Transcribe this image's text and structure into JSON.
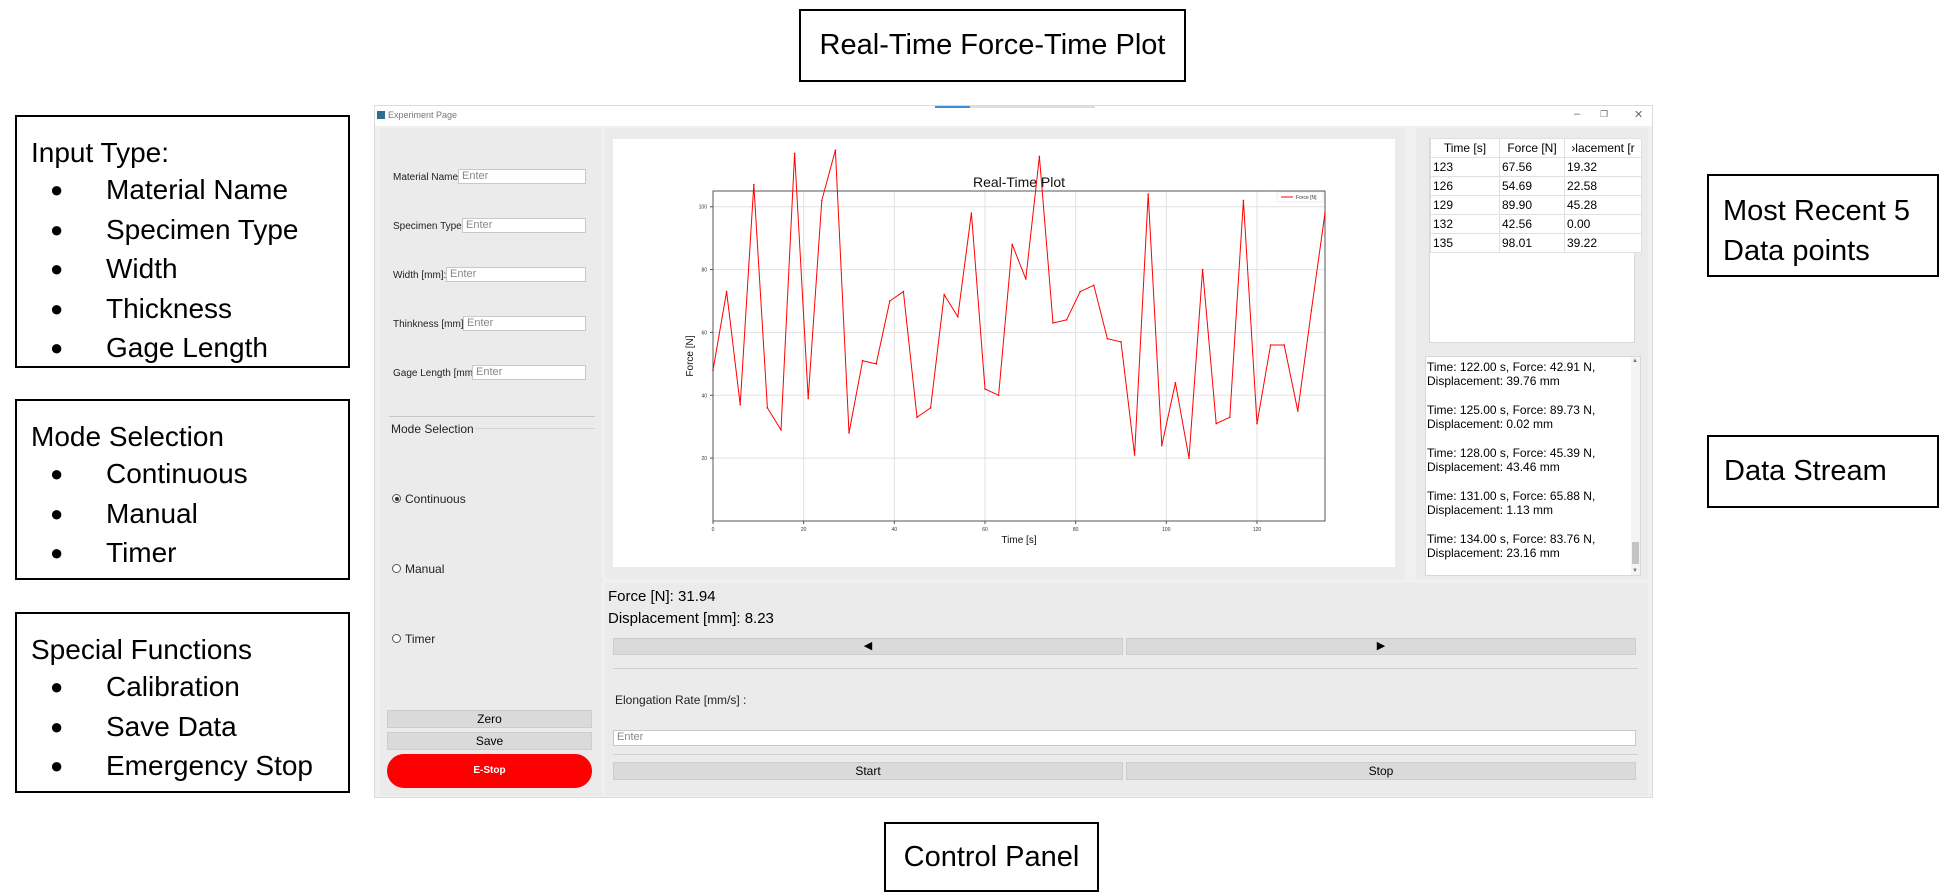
{
  "annotations": {
    "top": "Real-Time Force-Time Plot",
    "bottom": "Control Panel",
    "right_recent": [
      "Most Recent 5",
      "Data points"
    ],
    "right_stream": "Data Stream",
    "input_type": {
      "title": "Input Type:",
      "items": [
        "Material Name",
        "Specimen Type",
        "Width",
        "Thickness",
        "Gage Length"
      ]
    },
    "mode_selection": {
      "title": "Mode Selection",
      "items": [
        "Continuous",
        "Manual",
        "Timer"
      ]
    },
    "special_functions": {
      "title": "Special Functions",
      "items": [
        "Calibration",
        "Save Data",
        "Emergency Stop"
      ]
    }
  },
  "window": {
    "title": "Experiment Page",
    "controls": [
      "–",
      "❐",
      "✕"
    ]
  },
  "inputs": [
    {
      "label": "Material Name:",
      "placeholder": "Enter"
    },
    {
      "label": "Specimen Type:",
      "placeholder": "Enter"
    },
    {
      "label": "Width [mm]:",
      "placeholder": "Enter"
    },
    {
      "label": "Thinkness [mm]:",
      "placeholder": "Enter"
    },
    {
      "label": "Gage Length [mm]:",
      "placeholder": "Enter"
    }
  ],
  "mode": {
    "title": "Mode Selection",
    "options": [
      "Continuous",
      "Manual",
      "Timer"
    ],
    "selected": "Continuous"
  },
  "buttons": {
    "zero": "Zero",
    "save": "Save",
    "estop": "E-Stop",
    "start": "Start",
    "stop": "Stop",
    "left": "◀",
    "right": "▶"
  },
  "colors": {
    "estop": "#ff0000",
    "line": "#ff0000"
  },
  "readout": {
    "force": "Force [N]: 31.94",
    "displacement": "Displacement [mm]: 8.23",
    "elongation_label": "Elongation Rate [mm/s] :",
    "elongation_placeholder": "Enter"
  },
  "recent": {
    "headers": [
      "Time [s]",
      "Force [N]",
      "Displacement [mm]"
    ],
    "header_visible": [
      "Time [s]",
      "Force [N]",
      "›lacement [r"
    ],
    "rows": [
      [
        "123",
        "67.56",
        "19.32"
      ],
      [
        "126",
        "54.69",
        "22.58"
      ],
      [
        "129",
        "89.90",
        "45.28"
      ],
      [
        "132",
        "42.56",
        "0.00"
      ],
      [
        "135",
        "98.01",
        "39.22"
      ]
    ]
  },
  "stream": [
    [
      "Time: 122.00 s, Force: 42.91 N,",
      "Displacement: 39.76 mm"
    ],
    [
      "Time: 125.00 s, Force: 89.73 N,",
      "Displacement: 0.02 mm"
    ],
    [
      "Time: 128.00 s, Force: 45.39 N,",
      "Displacement: 43.46 mm"
    ],
    [
      "Time: 131.00 s, Force: 65.88 N,",
      "Displacement: 1.13 mm"
    ],
    [
      "Time: 134.00 s, Force: 83.76 N,",
      "Displacement: 23.16 mm"
    ]
  ],
  "chart_data": {
    "type": "line",
    "title": "Real-Time Plot",
    "xlabel": "Time [s]",
    "ylabel": "Force [N]",
    "xlim": [
      0,
      135
    ],
    "ylim": [
      0,
      105
    ],
    "xticks": [
      0,
      20,
      40,
      60,
      80,
      100,
      120
    ],
    "yticks": [
      20,
      40,
      60,
      80,
      100
    ],
    "grid": true,
    "legend": "top-right",
    "series": [
      {
        "name": "Force [N]",
        "color": "#ff0000",
        "x": [
          0,
          3,
          6,
          9,
          12,
          15,
          18,
          21,
          24,
          27,
          30,
          33,
          36,
          39,
          42,
          45,
          48,
          51,
          54,
          57,
          60,
          63,
          66,
          69,
          72,
          75,
          78,
          81,
          84,
          87,
          90,
          93,
          96,
          99,
          102,
          105,
          108,
          111,
          114,
          117,
          120,
          123,
          126,
          129,
          132,
          135
        ],
        "values": [
          48,
          73,
          37,
          107,
          36,
          29,
          117,
          39,
          102,
          118,
          28,
          51,
          50,
          70,
          73,
          33,
          36,
          72,
          65,
          98,
          42,
          40,
          88,
          77,
          116,
          63,
          64,
          73,
          75,
          58,
          57,
          21,
          104,
          24,
          44,
          20,
          80,
          31,
          33,
          102,
          31,
          56,
          56,
          35,
          67,
          98
        ]
      }
    ]
  }
}
